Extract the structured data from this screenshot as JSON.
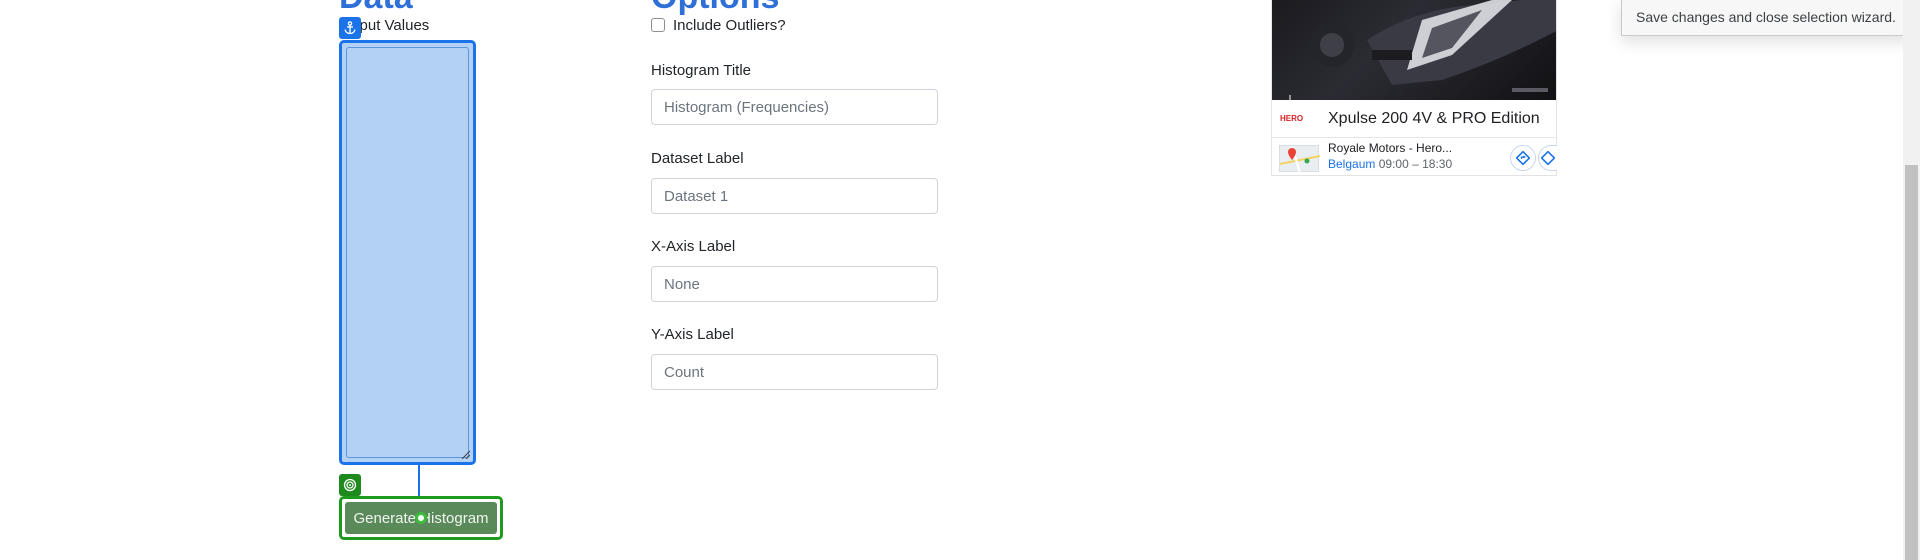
{
  "data_section": {
    "heading": "Data",
    "input_label": "Input Values",
    "input_value": "",
    "generate_button": "Generate Histogram"
  },
  "options_section": {
    "heading": "Options",
    "include_outliers_label": "Include Outliers?",
    "include_outliers_checked": false,
    "fields": [
      {
        "label": "Histogram Title",
        "placeholder": "Histogram (Frequencies)"
      },
      {
        "label": "Dataset Label",
        "placeholder": "Dataset 1"
      },
      {
        "label": "X-Axis Label",
        "placeholder": "None"
      },
      {
        "label": "Y-Axis Label",
        "placeholder": "Count"
      }
    ]
  },
  "ad": {
    "brand": "HERO",
    "title": "Xpulse 200 4V & PRO Edition",
    "dealer_name": "Royale Motors - Hero...",
    "dealer_city": "Belgaum",
    "dealer_hours": "09:00 – 18:30"
  },
  "tooltip": {
    "text": "Save changes and close selection wizard."
  },
  "colors": {
    "accent": "#1a73e8",
    "selection_fill": "#b3d1f5",
    "target_green": "#1e9a1e",
    "button_green": "#5a8a5a"
  }
}
